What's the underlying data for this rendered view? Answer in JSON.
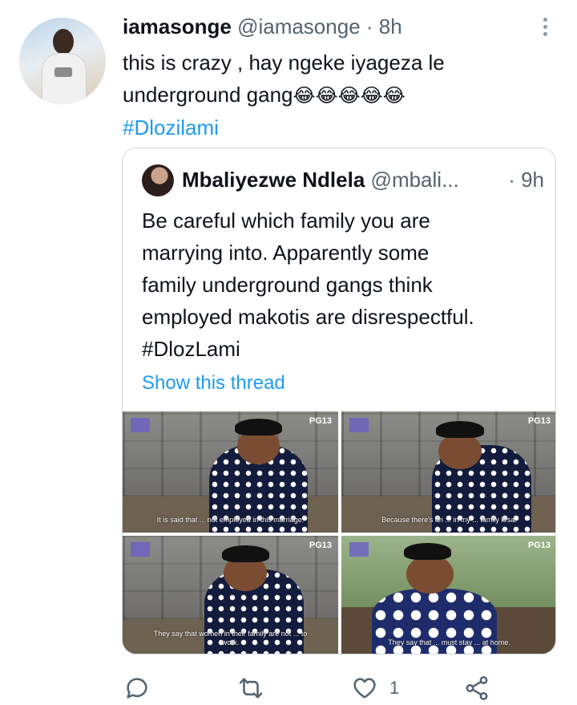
{
  "tweet": {
    "author_name": "iamasonge",
    "author_handle": "@iamasonge",
    "separator": "·",
    "time": "8h",
    "text_line1": "this is crazy , hay ngeke iyageza le",
    "text_line2": "underground gang",
    "emojis": "😂😂😂😂😂",
    "hashtag": "#Dlozilami"
  },
  "quoted": {
    "author_name": "Mbaliyezwe Ndlela",
    "author_handle": "@mbali...",
    "time": "· 9h",
    "lines": [
      "Be careful which family you are",
      "marrying into. Apparently some",
      "family underground gangs think",
      "employed makotis are disrespectful.",
      "#DlozLami"
    ],
    "show_thread": "Show this thread",
    "media": [
      {
        "rating": "PG13",
        "subtitle": "It is said that ... not employed in this marriage."
      },
      {
        "rating": "PG13",
        "subtitle": "Because there's an ... in my ... family krsa."
      },
      {
        "rating": "PG13",
        "subtitle": "They say that women in their family are not ... to work."
      },
      {
        "rating": "PG13",
        "subtitle": "They say that ... must stay ... at home."
      }
    ]
  },
  "actions": {
    "reply_icon": "reply-icon",
    "retweet_icon": "retweet-icon",
    "like_icon": "heart-icon",
    "like_count": "1",
    "share_icon": "share-icon"
  },
  "colors": {
    "accent": "#1d9bf0",
    "text": "#0f1419",
    "muted": "#536471",
    "border": "#cfd9de",
    "icon": "#536471"
  }
}
